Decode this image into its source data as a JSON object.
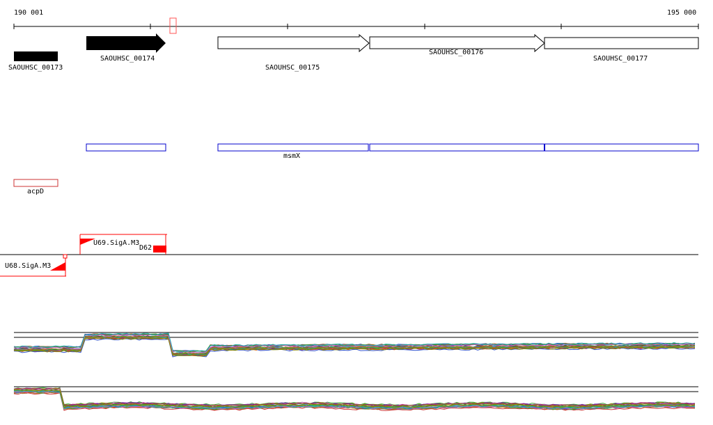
{
  "ruler": {
    "start_label": "190 001",
    "end_label": "195 000"
  },
  "genes": [
    {
      "label": "SAOUHSC_00173"
    },
    {
      "label": "SAOUHSC_00174"
    },
    {
      "label": "SAOUHSC_00175"
    },
    {
      "label": "SAOUHSC_00176"
    },
    {
      "label": "SAOUHSC_00177"
    }
  ],
  "annotations": [
    {
      "label": "msmX"
    },
    {
      "label": "acpD"
    }
  ],
  "promoters": [
    {
      "label": "U69.SigA.M3"
    },
    {
      "label": "D62"
    },
    {
      "label": "U68.SigA.M3"
    }
  ],
  "colors": {
    "gene_fill": "#000000",
    "outline_blue": "#0000cc",
    "promoter_red": "#ff0000",
    "axis": "#000000"
  }
}
